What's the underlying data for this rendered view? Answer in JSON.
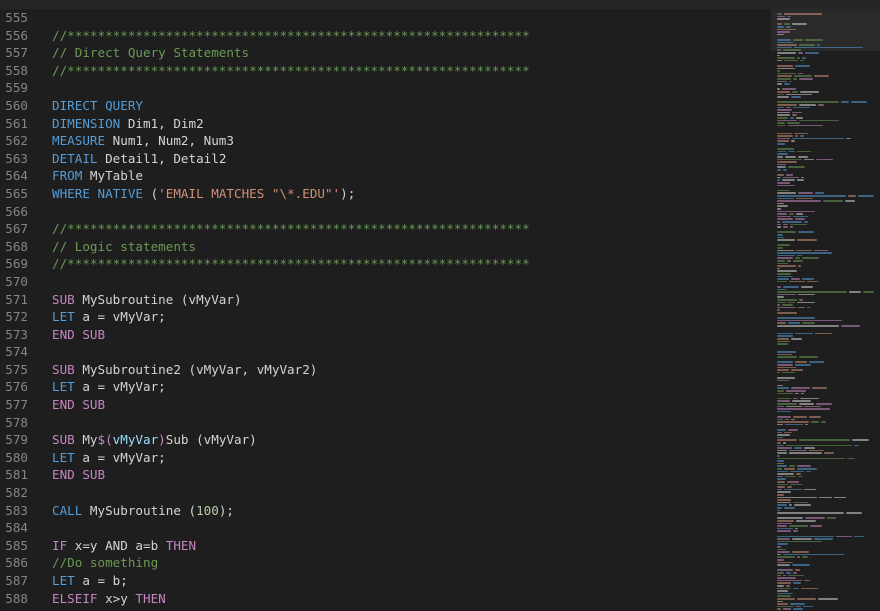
{
  "colors": {
    "background": "#1e1e1e",
    "gutter_text": "#858585",
    "default_text": "#d4d4d4",
    "comment": "#6a9955",
    "keyword_blue": "#569cd6",
    "keyword_purple": "#c586c0",
    "string": "#ce9178",
    "number": "#b5cea8",
    "variable": "#9cdcfe"
  },
  "editor": {
    "lines": [
      {
        "num": "555",
        "tokens": []
      },
      {
        "num": "556",
        "tokens": [
          {
            "t": "//*************************************************************",
            "c": "comment"
          }
        ]
      },
      {
        "num": "557",
        "tokens": [
          {
            "t": "// Direct Query Statements",
            "c": "comment"
          }
        ]
      },
      {
        "num": "558",
        "tokens": [
          {
            "t": "//*************************************************************",
            "c": "comment"
          }
        ]
      },
      {
        "num": "559",
        "tokens": []
      },
      {
        "num": "560",
        "tokens": [
          {
            "t": "DIRECT QUERY",
            "c": "keyword_blue"
          }
        ]
      },
      {
        "num": "561",
        "tokens": [
          {
            "t": "DIMENSION",
            "c": "keyword_blue"
          },
          {
            "t": " Dim1, Dim2",
            "c": "default"
          }
        ]
      },
      {
        "num": "562",
        "tokens": [
          {
            "t": "MEASURE",
            "c": "keyword_blue"
          },
          {
            "t": " Num1, Num2, Num3",
            "c": "default"
          }
        ]
      },
      {
        "num": "563",
        "tokens": [
          {
            "t": "DETAIL",
            "c": "keyword_blue"
          },
          {
            "t": " Detail1, Detail2",
            "c": "default"
          }
        ]
      },
      {
        "num": "564",
        "tokens": [
          {
            "t": "FROM",
            "c": "keyword_blue"
          },
          {
            "t": " MyTable",
            "c": "default"
          }
        ]
      },
      {
        "num": "565",
        "tokens": [
          {
            "t": "WHERE NATIVE",
            "c": "keyword_blue"
          },
          {
            "t": " (",
            "c": "default"
          },
          {
            "t": "'EMAIL MATCHES \"\\*.EDU\"'",
            "c": "string"
          },
          {
            "t": ");",
            "c": "default"
          }
        ]
      },
      {
        "num": "566",
        "tokens": []
      },
      {
        "num": "567",
        "tokens": [
          {
            "t": "//*************************************************************",
            "c": "comment"
          }
        ]
      },
      {
        "num": "568",
        "tokens": [
          {
            "t": "// Logic statements",
            "c": "comment"
          }
        ]
      },
      {
        "num": "569",
        "tokens": [
          {
            "t": "//*************************************************************",
            "c": "comment"
          }
        ]
      },
      {
        "num": "570",
        "tokens": []
      },
      {
        "num": "571",
        "tokens": [
          {
            "t": "SUB",
            "c": "keyword_purple"
          },
          {
            "t": " MySubroutine (vMyVar)",
            "c": "default"
          }
        ]
      },
      {
        "num": "572",
        "tokens": [
          {
            "t": "LET",
            "c": "keyword_blue"
          },
          {
            "t": " a = vMyVar;",
            "c": "default"
          }
        ]
      },
      {
        "num": "573",
        "tokens": [
          {
            "t": "END SUB",
            "c": "keyword_purple"
          }
        ]
      },
      {
        "num": "574",
        "tokens": []
      },
      {
        "num": "575",
        "tokens": [
          {
            "t": "SUB",
            "c": "keyword_purple"
          },
          {
            "t": " MySubroutine2 (vMyVar, vMyVar2)",
            "c": "default"
          }
        ]
      },
      {
        "num": "576",
        "tokens": [
          {
            "t": "LET",
            "c": "keyword_blue"
          },
          {
            "t": " a = vMyVar;",
            "c": "default"
          }
        ]
      },
      {
        "num": "577",
        "tokens": [
          {
            "t": "END SUB",
            "c": "keyword_purple"
          }
        ]
      },
      {
        "num": "578",
        "tokens": []
      },
      {
        "num": "579",
        "tokens": [
          {
            "t": "SUB",
            "c": "keyword_purple"
          },
          {
            "t": " My",
            "c": "default"
          },
          {
            "t": "$(",
            "c": "keyword_purple"
          },
          {
            "t": "vMyVar",
            "c": "variable"
          },
          {
            "t": ")",
            "c": "keyword_purple"
          },
          {
            "t": "Sub (vMyVar)",
            "c": "default"
          }
        ]
      },
      {
        "num": "580",
        "tokens": [
          {
            "t": "LET",
            "c": "keyword_blue"
          },
          {
            "t": " a = vMyVar;",
            "c": "default"
          }
        ]
      },
      {
        "num": "581",
        "tokens": [
          {
            "t": "END SUB",
            "c": "keyword_purple"
          }
        ]
      },
      {
        "num": "582",
        "tokens": []
      },
      {
        "num": "583",
        "tokens": [
          {
            "t": "CALL",
            "c": "keyword_blue"
          },
          {
            "t": " MySubroutine (",
            "c": "default"
          },
          {
            "t": "100",
            "c": "number"
          },
          {
            "t": ");",
            "c": "default"
          }
        ]
      },
      {
        "num": "584",
        "tokens": []
      },
      {
        "num": "585",
        "tokens": [
          {
            "t": "IF",
            "c": "keyword_purple"
          },
          {
            "t": " x=y ",
            "c": "default"
          },
          {
            "t": "AND",
            "c": "default"
          },
          {
            "t": " a=b ",
            "c": "default"
          },
          {
            "t": "THEN",
            "c": "keyword_purple"
          }
        ]
      },
      {
        "num": "586",
        "tokens": [
          {
            "t": "//Do something",
            "c": "comment"
          }
        ]
      },
      {
        "num": "587",
        "tokens": [
          {
            "t": "LET",
            "c": "keyword_blue"
          },
          {
            "t": " a = b;",
            "c": "default"
          }
        ]
      },
      {
        "num": "588",
        "tokens": [
          {
            "t": "ELSEIF",
            "c": "keyword_purple"
          },
          {
            "t": " x>y ",
            "c": "default"
          },
          {
            "t": "THEN",
            "c": "keyword_purple"
          }
        ]
      }
    ]
  }
}
